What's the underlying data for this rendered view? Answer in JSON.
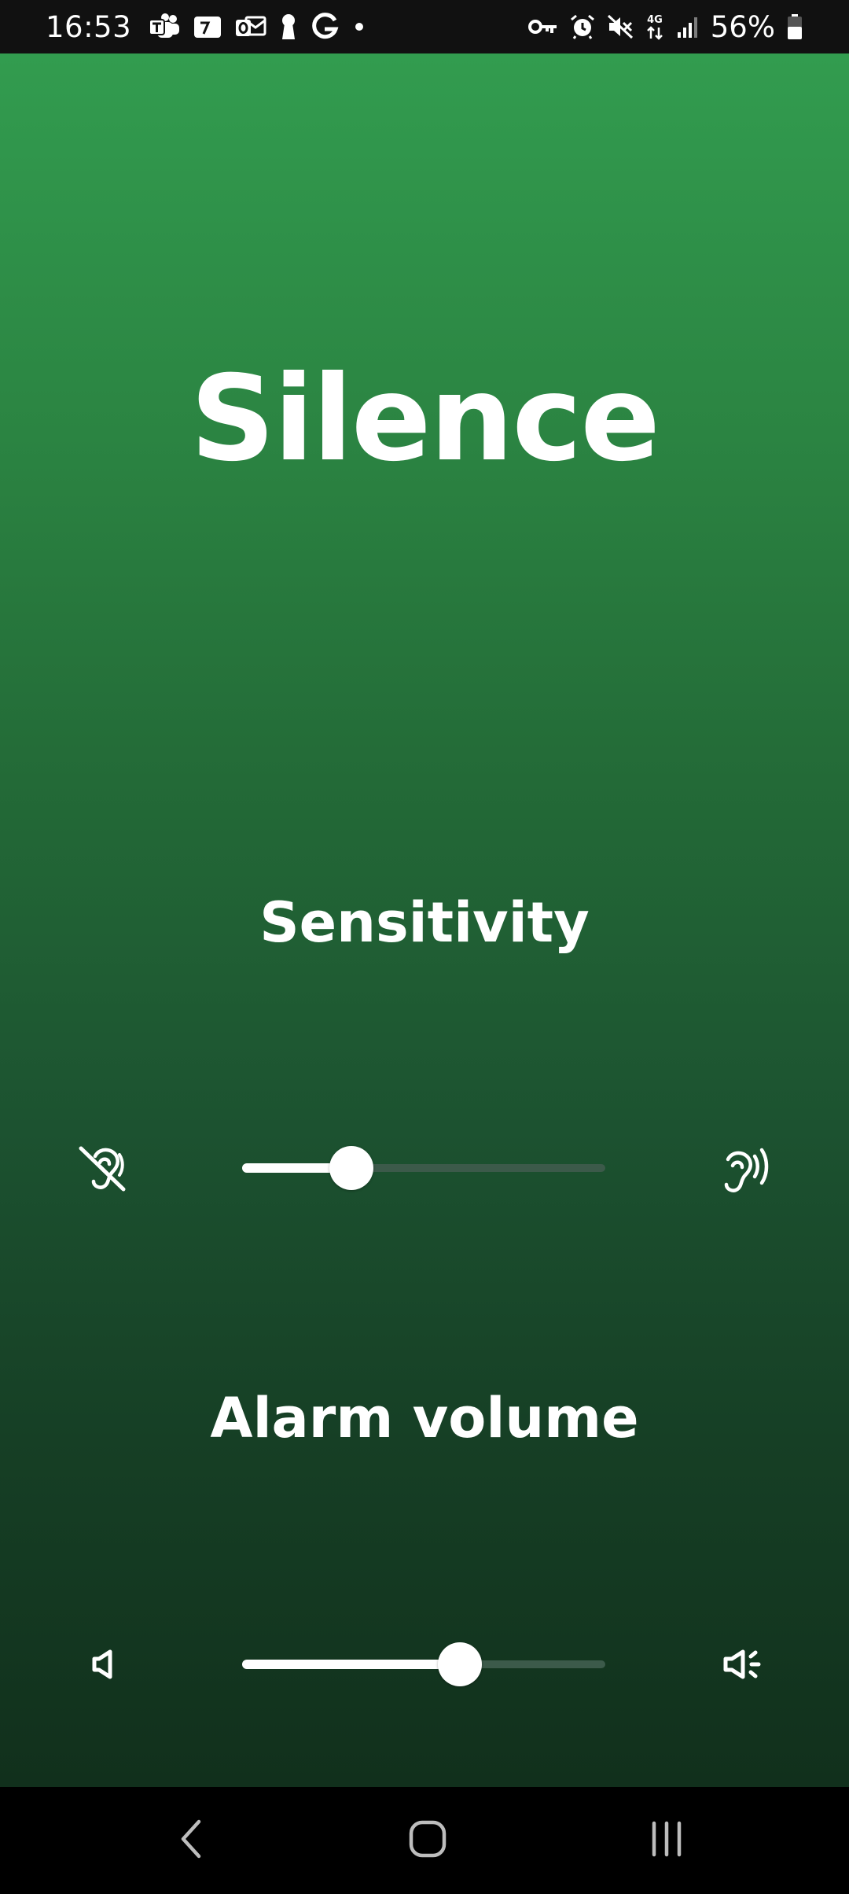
{
  "status_bar": {
    "time": "16:53",
    "battery_percent": "56%",
    "left_icons": [
      "teams-icon",
      "calendar-icon",
      "outlook-icon",
      "keyhole-icon",
      "google-icon",
      "dot-icon"
    ],
    "right_icons": [
      "vpn-key-icon",
      "alarm-icon",
      "mute-icon",
      "4g-data-icon",
      "signal-icon",
      "battery-icon"
    ]
  },
  "main": {
    "title": "Silence",
    "sensitivity": {
      "label": "Sensitivity",
      "value": 0.3,
      "left_icon": "hearing-disabled-icon",
      "right_icon": "hearing-icon"
    },
    "alarm_volume": {
      "label": "Alarm volume",
      "value": 0.6,
      "left_icon": "volume-mute-icon",
      "right_icon": "volume-up-icon"
    }
  },
  "nav_bar": {
    "buttons": [
      "back-icon",
      "home-icon",
      "recents-icon"
    ]
  },
  "colors": {
    "gradient_top": "#329c4f",
    "gradient_bottom": "#11301c",
    "slider_fill": "#ffffff",
    "slider_track": "#3c5a4a"
  }
}
